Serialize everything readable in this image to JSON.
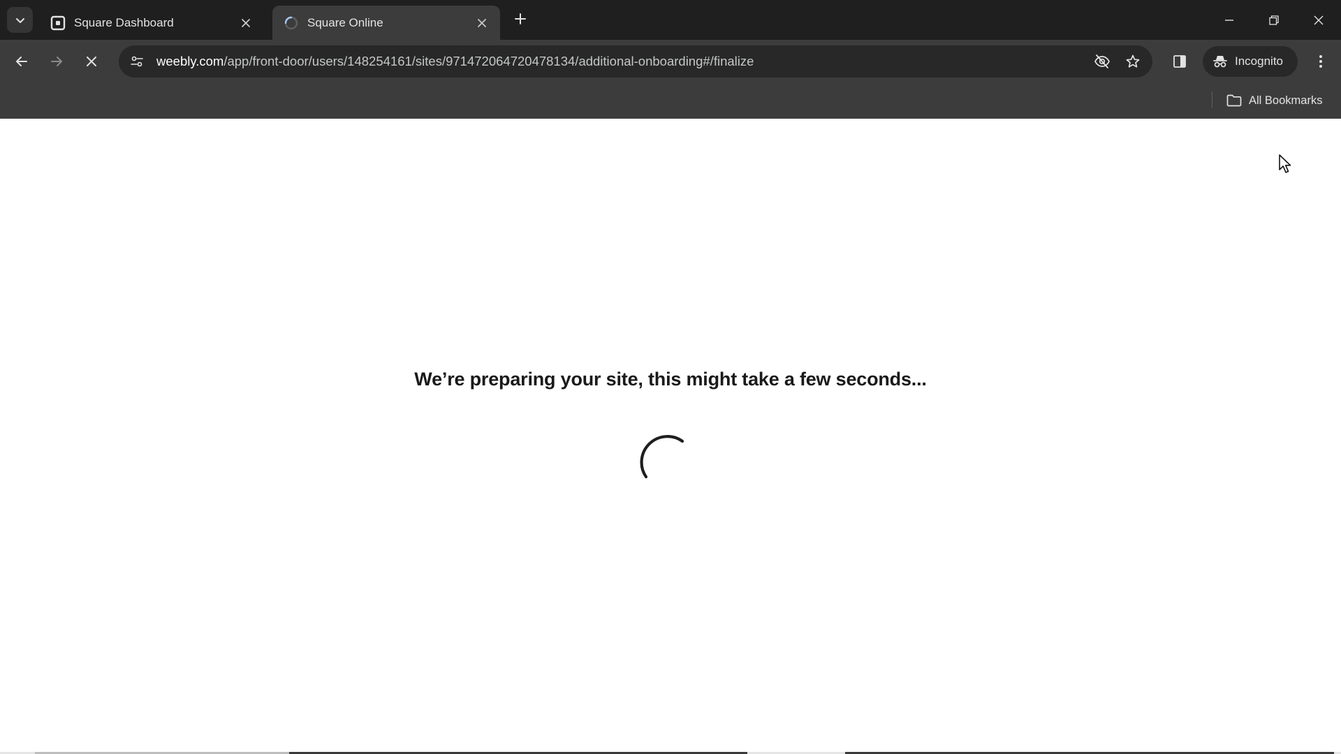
{
  "tabs": [
    {
      "title": "Square Dashboard",
      "favicon": "square-logo-icon",
      "active": false
    },
    {
      "title": "Square Online",
      "favicon": "loading-spinner-icon",
      "active": true
    }
  ],
  "address_bar": {
    "url_host": "weebly.com",
    "url_path": "/app/front-door/users/148254161/sites/971472064720478134/additional-onboarding#/finalize"
  },
  "incognito_label": "Incognito",
  "bookmarks": {
    "all_bookmarks_label": "All Bookmarks"
  },
  "page": {
    "message": "We’re preparing your site, this might take a few seconds..."
  },
  "colors": {
    "tabstrip_bg": "#1f1f1f",
    "toolbar_bg": "#3c3c3c",
    "omnibox_bg": "#282828",
    "page_bg": "#ffffff",
    "message_text": "#1a1a1a"
  }
}
